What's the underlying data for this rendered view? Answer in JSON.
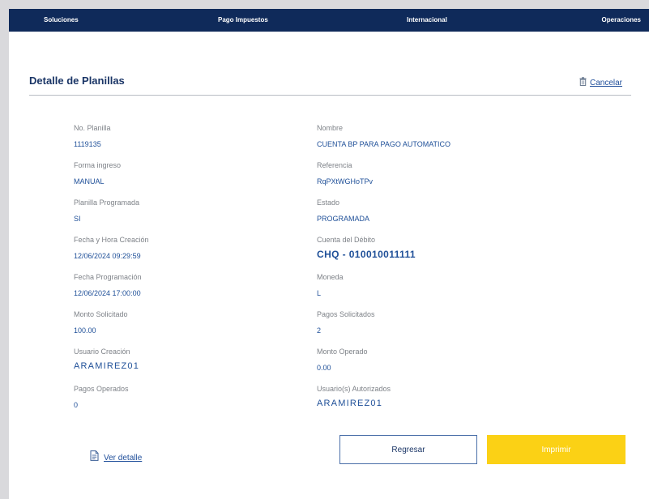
{
  "nav": [
    "Soluciones",
    "Pago Impuestos",
    "Internacional",
    "Operaciones"
  ],
  "page": {
    "title": "Detalle de Planillas",
    "cancel_label": "Cancelar"
  },
  "left_fields": [
    {
      "label": "No. Planilla",
      "value": "1119135"
    },
    {
      "label": "Forma ingreso",
      "value": "MANUAL"
    },
    {
      "label": "Planilla Programada",
      "value": "SI"
    },
    {
      "label": "Fecha y Hora Creación",
      "value": "12/06/2024 09:29:59"
    },
    {
      "label": "Fecha Programación",
      "value": "12/06/2024 17:00:00"
    },
    {
      "label": "Monto Solicitado",
      "value": "100.00"
    },
    {
      "label": "Usuario Creación",
      "value": "ARAMIREZ01"
    },
    {
      "label": "Pagos Operados",
      "value": "0"
    }
  ],
  "right_fields": [
    {
      "label": "Nombre",
      "value": "CUENTA BP PARA PAGO AUTOMATICO"
    },
    {
      "label": "Referencia",
      "value": "RqPXtWGHoTPv"
    },
    {
      "label": "Estado",
      "value": "PROGRAMADA"
    },
    {
      "label": "Cuenta del Débito",
      "value": "CHQ - 010010011111"
    },
    {
      "label": "Moneda",
      "value": "L"
    },
    {
      "label": "Pagos Solicitados",
      "value": "2"
    },
    {
      "label": "Monto Operado",
      "value": "0.00"
    },
    {
      "label": "Usuario(s) Autorizados",
      "value": "ARAMIREZ01"
    }
  ],
  "actions": {
    "ver_detalle": "Ver detalle",
    "regresar": "Regresar",
    "imprimir": "Imprimir"
  },
  "icons": {
    "cancel": "trash-icon",
    "ver_detalle": "document-icon"
  },
  "colors": {
    "nav_bg": "#0f2a5a",
    "title": "#1a3566",
    "value": "#1e4f98",
    "label": "#7e8288",
    "primary_button": "#fbd115"
  }
}
